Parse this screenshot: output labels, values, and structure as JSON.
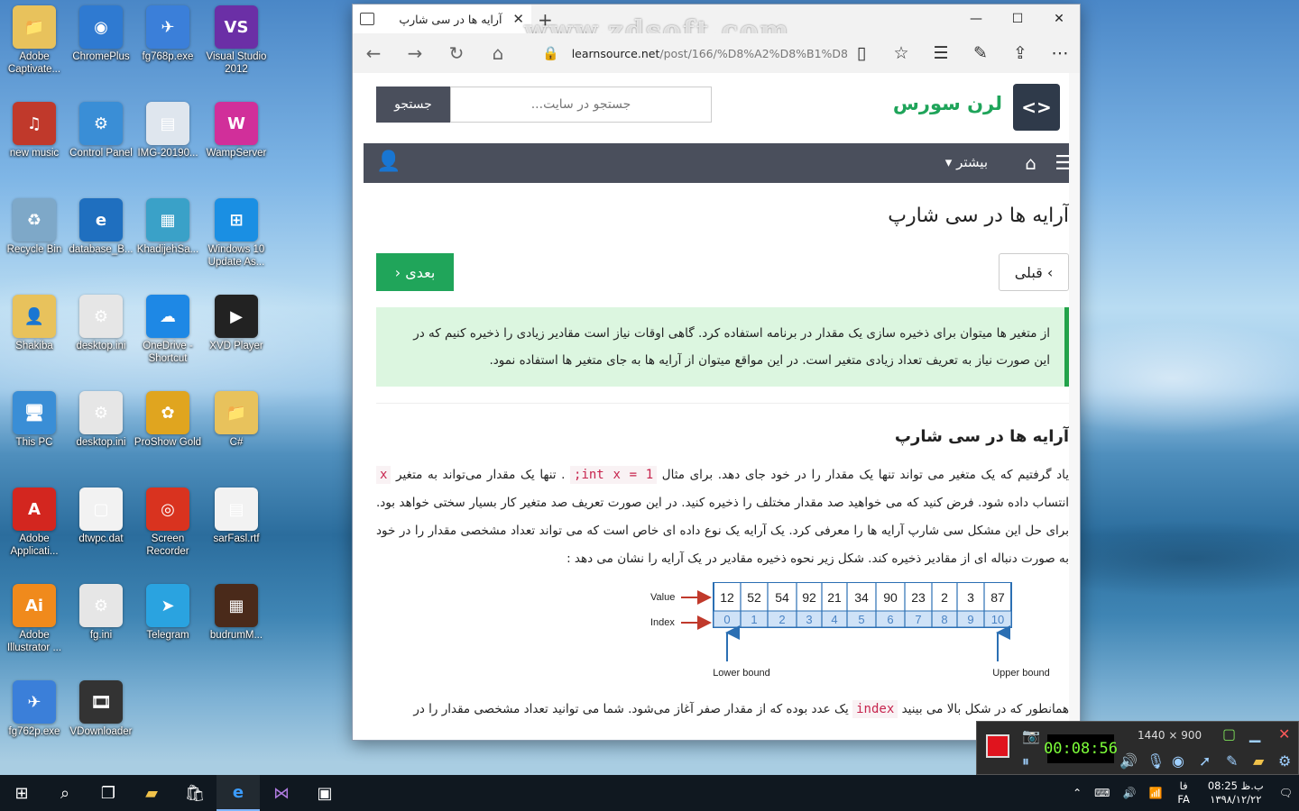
{
  "desktop": {
    "icons": [
      {
        "label": "Adobe Captivate...",
        "color": "#e8c25c",
        "glyph": "📁"
      },
      {
        "label": "ChromePlus",
        "color": "#2f7ad1",
        "glyph": "◉"
      },
      {
        "label": "fg768p.exe",
        "color": "#3b7fd9",
        "glyph": "✈"
      },
      {
        "label": "Visual Studio 2012",
        "color": "#6b2fa6",
        "glyph": "VS"
      },
      {
        "label": "new music",
        "color": "#c0392b",
        "glyph": "♫"
      },
      {
        "label": "Control Panel",
        "color": "#3a8ed6",
        "glyph": "⚙"
      },
      {
        "label": "IMG-20190...",
        "color": "#dfe6ee",
        "glyph": "▤"
      },
      {
        "label": "WampServer",
        "color": "#d12f9a",
        "glyph": "W"
      },
      {
        "label": "Recycle Bin",
        "color": "#7ea8c8",
        "glyph": "♻"
      },
      {
        "label": "database_B...",
        "color": "#1f6fbf",
        "glyph": "e"
      },
      {
        "label": "KhadijehSa...",
        "color": "#3aa1c8",
        "glyph": "▦"
      },
      {
        "label": "Windows 10 Update As...",
        "color": "#1a8fe3",
        "glyph": "⊞"
      },
      {
        "label": "Shakiba",
        "color": "#e8c25c",
        "glyph": "👤"
      },
      {
        "label": "desktop.ini",
        "color": "#e6e6e6",
        "glyph": "⚙"
      },
      {
        "label": "OneDrive - Shortcut",
        "color": "#1e88e5",
        "glyph": "☁"
      },
      {
        "label": "XVD Player",
        "color": "#222222",
        "glyph": "▶"
      },
      {
        "label": "This PC",
        "color": "#3a8ed6",
        "glyph": "🖥"
      },
      {
        "label": "desktop.ini",
        "color": "#e6e6e6",
        "glyph": "⚙"
      },
      {
        "label": "ProShow Gold",
        "color": "#e0a51f",
        "glyph": "✿"
      },
      {
        "label": "C#",
        "color": "#e8c25c",
        "glyph": "📁"
      },
      {
        "label": "Adobe Applicati...",
        "color": "#d3261f",
        "glyph": "A"
      },
      {
        "label": "dtwpc.dat",
        "color": "#f2f2f2",
        "glyph": "▢"
      },
      {
        "label": "Screen Recorder",
        "color": "#d9331f",
        "glyph": "◎"
      },
      {
        "label": "sarFasl.rtf",
        "color": "#f2f2f2",
        "glyph": "▤"
      },
      {
        "label": "Adobe Illustrator ...",
        "color": "#f08a1c",
        "glyph": "Ai"
      },
      {
        "label": "fg.ini",
        "color": "#e6e6e6",
        "glyph": "⚙"
      },
      {
        "label": "Telegram",
        "color": "#2aa3e0",
        "glyph": "➤"
      },
      {
        "label": "budrumM...",
        "color": "#4a2a1a",
        "glyph": "▦"
      },
      {
        "label": "fg762p.exe",
        "color": "#3b7fd9",
        "glyph": "✈"
      },
      {
        "label": "VDownloader",
        "color": "#333333",
        "glyph": "🎞"
      }
    ]
  },
  "browser": {
    "tab_title": "آرایه ها در سی شارپ",
    "watermark": "www.zdsoft.com",
    "url_host": "learnsource.net",
    "url_path": "/post/166/%D8%A2%D8%B1%D8",
    "site": {
      "logo_text": "لرن سورس",
      "search_placeholder": "جستجو در سایت...",
      "search_button": "جستجو",
      "menu_more": "بیشتر",
      "page_title": "آرایه ها در سی شارپ",
      "prev_button": "قبلی",
      "next_button": "بعدی",
      "intro_line1": "از متغیر ها میتوان برای ذخیره سازی یک مقدار در برنامه استفاده کرد. گاهی اوقات نیاز است مقادیر زیادی را ذخیره کنیم که در",
      "intro_line2": "این صورت نیاز به تعریف تعداد زیادی متغیر است. در این مواقع میتوان از آرایه ها به جای متغیر ها استفاده نمود.",
      "section_title": "آرایه ها در سی شارپ",
      "para_a": "یاد گرفتیم که یک متغیر می تواند تنها یک مقدار را در خود جای دهد. برای مثال",
      "code_int": "int x = 1;",
      "para_b": ". تنها یک مقدار می‌تواند به متغیر",
      "code_x": "x",
      "para_c": "انتساب داده شود. فرض کنید که می خواهید صد مقدار مختلف را ذخیره کنید. در این صورت تعریف صد متغیر کار بسیار سختی خواهد بود. برای حل این مشکل سی شارپ آرایه ها را معرفی کرد. یک آرایه یک نوع داده ای خاص است که می تواند تعداد مشخصی مقدار را در خود به صورت دنباله ای از مقادیر ذخیره کند. شکل زیر نحوه ذخیره مقادیر در یک آرایه را نشان می دهد :",
      "diagram": {
        "value_label": "Value",
        "index_label": "Index",
        "values": [
          "12",
          "52",
          "54",
          "92",
          "21",
          "34",
          "90",
          "23",
          "2",
          "3",
          "87"
        ],
        "indices": [
          "0",
          "1",
          "2",
          "3",
          "4",
          "5",
          "6",
          "7",
          "8",
          "9",
          "10"
        ],
        "lower_label": "Lower bound",
        "upper_label": "Upper bound"
      },
      "para_d1": "همانطور که در شکل بالا می بینید",
      "code_index": "index",
      "para_d2": "یک عدد بوده که از مقدار صفر آغاز می‌شود. شما می توانید تعداد مشخصی مقدار را در"
    }
  },
  "recorder": {
    "time": "00:08:56",
    "resolution": "1440 × 900"
  },
  "taskbar": {
    "lang_top": "فا",
    "lang": "FA",
    "time": "08:25 ب.ظ",
    "date": "۱۳۹۸/۱۲/۲۲"
  }
}
